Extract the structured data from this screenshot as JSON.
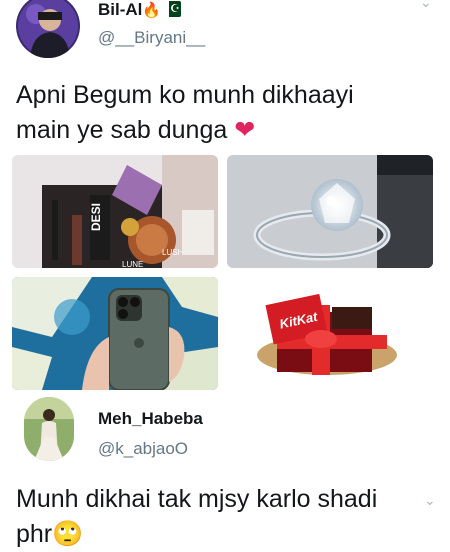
{
  "tweet": {
    "author_name": "Bil-Al",
    "author_handle": "@__Biryani__",
    "name_emoji_fire": "🔥",
    "text": "Apni Begum ko munh dikhaayi main ye sab dunga",
    "text_line1": "Apni Begum ko munh dikhaayi",
    "text_line2": "main ye sab dunga",
    "heart_emoji": "❤",
    "chevron": "⌄",
    "images": [
      {
        "name": "makeup-gift-box-image"
      },
      {
        "name": "diamond-ring-image"
      },
      {
        "name": "iphone-image"
      },
      {
        "name": "kitkat-chocolate-box-image"
      }
    ],
    "image_texts": {
      "kitkat": "KitKat",
      "lush": "LUSH",
      "lune": "LUNE"
    }
  },
  "reply": {
    "author_name": "Meh_Habeba",
    "author_handle": "@k_abjaoO",
    "text_line1": "Munh dikhai tak mjsy karlo shadi",
    "text_line2": "phr",
    "emoji": "🙄",
    "chevron": "⌄"
  },
  "colors": {
    "text": "#14171a",
    "secondary": "#657786",
    "heart": "#e0245e"
  }
}
